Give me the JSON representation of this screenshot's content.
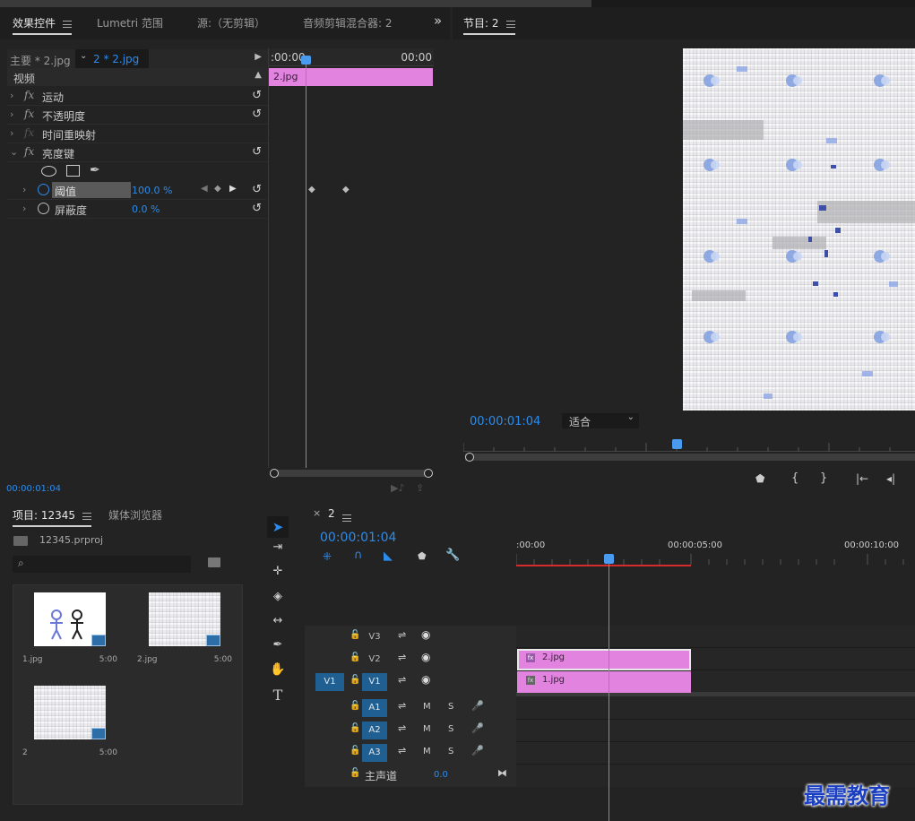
{
  "effect_controls": {
    "tabs": [
      "效果控件",
      "Lumetri 范围",
      "源:（无剪辑）",
      "音频剪辑混合器: 2"
    ],
    "overflow": "»",
    "master_clip": "主要 * 2.jpg",
    "active_clip": "2 * 2.jpg",
    "time_start": ":00:00",
    "time_end": "00:00",
    "clip_bar_label": "2.jpg",
    "section_video": "视频",
    "effects": [
      {
        "label": "运动",
        "chev": "›",
        "fx": "fx"
      },
      {
        "label": "不透明度",
        "chev": "›",
        "fx": "fx"
      },
      {
        "label": "时间重映射",
        "chev": "›",
        "fx": "fx"
      },
      {
        "label": "亮度键",
        "chev": "⌄",
        "fx": "fx"
      }
    ],
    "params": [
      {
        "label": "阈值",
        "value": "100.0 %"
      },
      {
        "label": "屏蔽度",
        "value": "0.0 %"
      }
    ],
    "timecode": "00:00:01:04",
    "reset_glyph": "↺"
  },
  "program_monitor": {
    "title": "节目: 2",
    "timecode": "00:00:01:04",
    "fit_label": "适合",
    "controls": [
      "⬟",
      "{",
      "}",
      "|←",
      "◂|"
    ]
  },
  "project": {
    "tabs": [
      "项目: 12345",
      "媒体浏览器"
    ],
    "file": "12345.prproj",
    "items": [
      {
        "name": "1.jpg",
        "duration": "5:00"
      },
      {
        "name": "2.jpg",
        "duration": "5:00"
      },
      {
        "name": "2",
        "duration": "5:00"
      }
    ]
  },
  "timeline": {
    "close": "×",
    "name": "2",
    "timecode": "00:00:01:04",
    "ruler": [
      ":00:00",
      "00:00:05:00",
      "00:00:10:00"
    ],
    "video_tracks": [
      "V3",
      "V2",
      "V1"
    ],
    "source_patch": "V1",
    "audio_tracks": [
      "A1",
      "A2",
      "A3"
    ],
    "mute": "M",
    "solo": "S",
    "master_label": "主声道",
    "master_value": "0.0",
    "clips": [
      {
        "name": "2.jpg",
        "track": "V2"
      },
      {
        "name": "1.jpg",
        "track": "V1"
      }
    ],
    "playhead_fraction": 0.13
  },
  "watermark": "最需教育",
  "colors": {
    "accent": "#2d8ceb",
    "clip_pink": "#e283e0",
    "track_active": "#1f5f92",
    "work_area": "#d42b2b"
  }
}
